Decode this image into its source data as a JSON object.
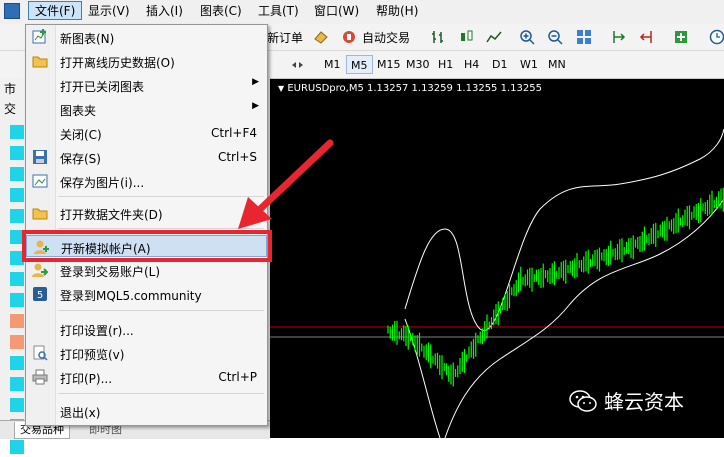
{
  "menubar": {
    "items": [
      "文件(F)",
      "显示(V)",
      "插入(I)",
      "图表(C)",
      "工具(T)",
      "窗口(W)",
      "帮助(H)"
    ]
  },
  "toolbar": {
    "new_order": "新订单",
    "auto_trade": "自动交易"
  },
  "timeframes": [
    "M1",
    "M5",
    "M15",
    "M30",
    "H1",
    "H4",
    "D1",
    "W1",
    "MN"
  ],
  "left_panel": {
    "header_fragment": "市",
    "column_fragment": "交",
    "tabs": [
      "交易品种",
      "即时图"
    ]
  },
  "chart": {
    "header": "EURUSDpro,M5  1.13257 1.13259 1.13255 1.13255",
    "colors": {
      "background": "#000000",
      "candles": "#00ff00",
      "bands": "#ffffff",
      "level_red": "#c00000",
      "level_gray": "#808080"
    }
  },
  "watermark": {
    "text": "蜂云资本",
    "icon": "wechat-logo-icon"
  },
  "file_menu": {
    "items": [
      {
        "label": "新图表(N)",
        "shortcut": "",
        "icon": "new-chart-icon",
        "submenu": false
      },
      {
        "label": "打开离线历史数据(O)",
        "shortcut": "",
        "icon": "open-folder-icon",
        "submenu": false
      },
      {
        "label": "打开已关闭图表",
        "shortcut": "",
        "icon": "",
        "submenu": true
      },
      {
        "label": "图表夹",
        "shortcut": "",
        "icon": "",
        "submenu": true
      },
      {
        "label": "关闭(C)",
        "shortcut": "Ctrl+F4",
        "icon": "",
        "submenu": false
      },
      {
        "label": "保存(S)",
        "shortcut": "Ctrl+S",
        "icon": "save-icon",
        "submenu": false
      },
      {
        "label": "保存为图片(i)...",
        "shortcut": "",
        "icon": "save-image-icon",
        "submenu": false
      },
      {
        "label": "打开数据文件夹(D)",
        "shortcut": "",
        "icon": "data-folder-icon",
        "submenu": false
      },
      {
        "label": "开新模拟帐户(A)",
        "shortcut": "",
        "icon": "new-demo-account-icon",
        "submenu": false
      },
      {
        "label": "登录到交易账户(L)",
        "shortcut": "",
        "icon": "login-icon",
        "submenu": false
      },
      {
        "label": "登录到MQL5.community",
        "shortcut": "",
        "icon": "mql5-icon",
        "submenu": false
      },
      {
        "label": "打印设置(r)...",
        "shortcut": "",
        "icon": "",
        "submenu": false
      },
      {
        "label": "打印预览(v)",
        "shortcut": "",
        "icon": "print-preview-icon",
        "submenu": false
      },
      {
        "label": "打印(P)...",
        "shortcut": "Ctrl+P",
        "icon": "print-icon",
        "submenu": false
      },
      {
        "label": "退出(x)",
        "shortcut": "",
        "icon": "",
        "submenu": false
      }
    ]
  }
}
